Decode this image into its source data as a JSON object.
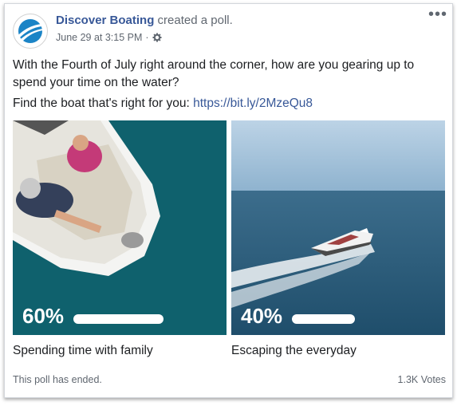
{
  "post": {
    "author": "Discover Boating",
    "action": "created a poll.",
    "date": "June 29 at 3:15 PM",
    "separator": "·",
    "body": "With the Fourth of July right around the corner, how are you gearing up to spend your time on the water?",
    "link_prefix": "Find the boat that's right for you:",
    "link_url": "https://bit.ly/2MzeQu8"
  },
  "poll": {
    "options": [
      {
        "percent_label": "60%",
        "percent": 60,
        "label": "Spending time with family"
      },
      {
        "percent_label": "40%",
        "percent": 40,
        "label": "Escaping the everyday"
      }
    ],
    "status": "This poll has ended.",
    "votes": "1.3K Votes"
  },
  "icons": {
    "avatar": "discover-boating-logo",
    "privacy": "gear-icon",
    "more": "more-options-icon"
  },
  "colors": {
    "author": "#385898",
    "meta": "#606770",
    "water": "#0e5a63",
    "sky": "#9fc3dd"
  }
}
